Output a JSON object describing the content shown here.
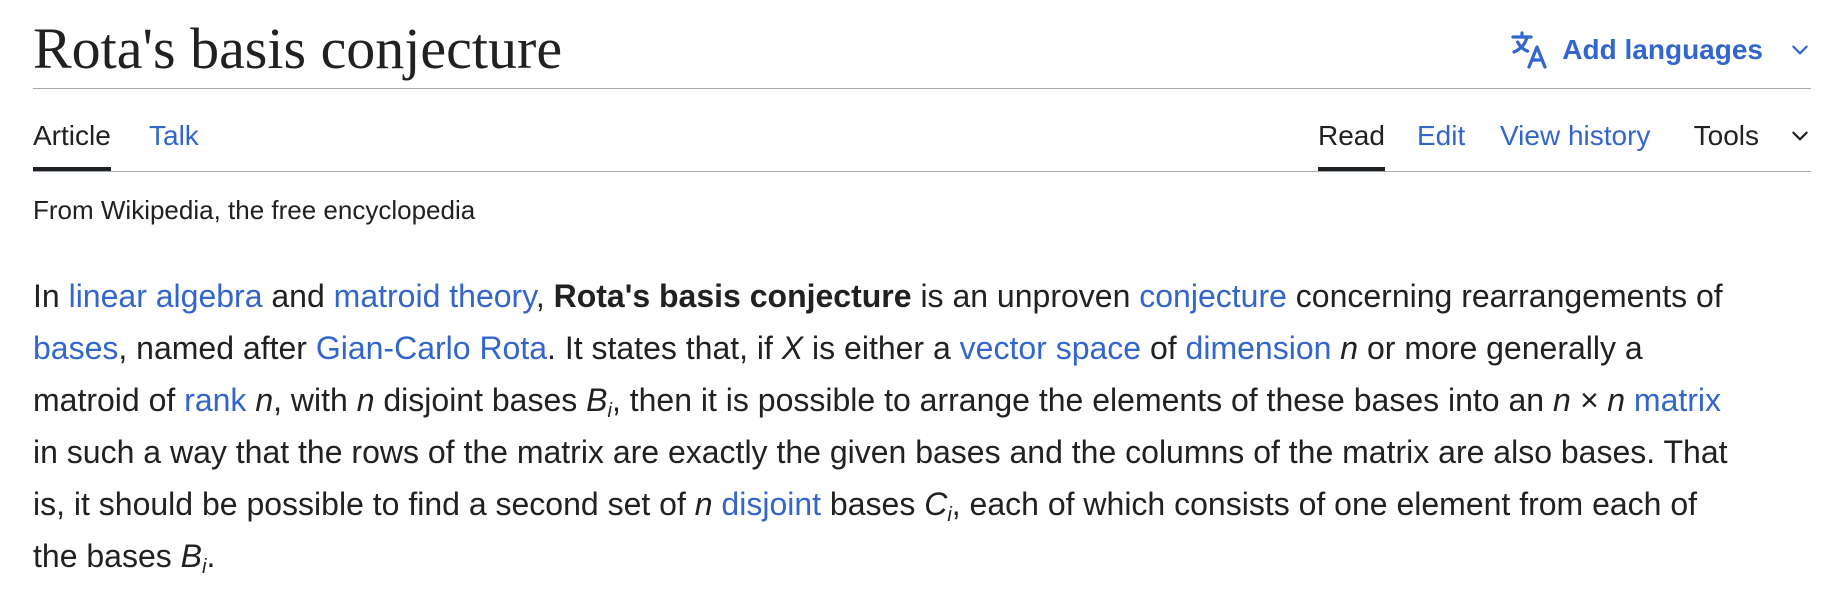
{
  "header": {
    "title": "Rota's basis conjecture",
    "languages_label": "Add languages",
    "languages_icon": "translate-icon",
    "chevron_icon": "chevron-down-icon"
  },
  "tabs": {
    "article": "Article",
    "talk": "Talk",
    "read": "Read",
    "edit": "Edit",
    "history": "View history",
    "tools": "Tools"
  },
  "tagline": "From Wikipedia, the free encyclopedia",
  "colors": {
    "link": "#3366cc",
    "text": "#202122",
    "divider": "#a2a9b1"
  },
  "paragraph": {
    "t1": "In ",
    "l_linear_algebra": "linear algebra",
    "t2": " and ",
    "l_matroid_theory": "matroid theory",
    "t3": ", ",
    "bold_term": "Rota's basis conjecture",
    "t4": " is an unproven ",
    "l_conjecture": "conjecture",
    "t5": " concerning rearrangements of",
    "l_bases": "bases",
    "t6": ", named after ",
    "l_gian_carlo_rota": "Gian-Carlo Rota",
    "t7": ". It states that, if ",
    "var_x": "X",
    "t8": " is either a ",
    "l_vector_space": "vector space",
    "t9": " of ",
    "l_dimension": "dimension",
    "t10": " ",
    "var_n1": "n",
    "t11": " or more generally a",
    "t12": "matroid of ",
    "l_rank": "rank",
    "t13": " ",
    "var_n2": "n",
    "t14": ", with ",
    "var_n3": "n",
    "t15": " disjoint bases ",
    "var_b1": "B",
    "sub_i1": "i",
    "t16": ", then it is possible to arrange the elements of these bases into an ",
    "expr_nxn": "n × n",
    "t17": " ",
    "l_matrix": "matrix",
    "t18": "in such a way that the rows of the matrix are exactly the given bases and the columns of the matrix are also bases. That",
    "t19": "is, it should be possible to find a second set of ",
    "var_n4": "n",
    "t20": " ",
    "l_disjoint": "disjoint",
    "t21": " bases ",
    "var_c": "C",
    "sub_i2": "i",
    "t22": ", each of which consists of one element from each of",
    "t23": "the bases ",
    "var_b2": "B",
    "sub_i3": "i",
    "t24": "."
  }
}
